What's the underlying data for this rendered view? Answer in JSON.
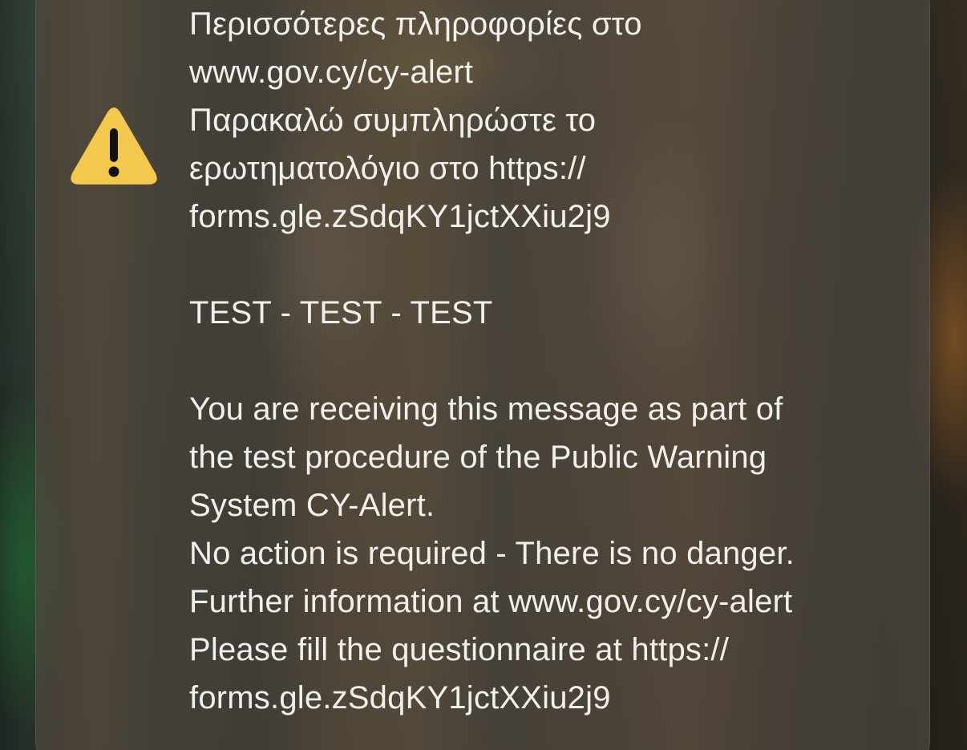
{
  "alert": {
    "icon": "warning-icon",
    "icon_color": "#F2C94C",
    "greek": {
      "more_info_line1": "Περισσότερες πληροφορίες στο",
      "more_info_line2": "www.gov.cy/cy-alert",
      "questionnaire_line1": "Παρακαλώ συμπληρώστε το",
      "questionnaire_line2": "ερωτηματολόγιο στο https://",
      "questionnaire_line3": "forms.gle.zSdqKY1jctXXiu2j9"
    },
    "test_marker": "TEST - TEST - TEST",
    "english": {
      "receiving_line1": "You are receiving this message as part of",
      "receiving_line2": "the test procedure of the Public Warning",
      "receiving_line3": "System CY-Alert.",
      "no_action": "No action is required - There is no danger.",
      "further_info": "Further information at www.gov.cy/cy-alert",
      "questionnaire_line1": "Please fill the questionnaire at https://",
      "questionnaire_line2": "forms.gle.zSdqKY1jctXXiu2j9"
    }
  }
}
